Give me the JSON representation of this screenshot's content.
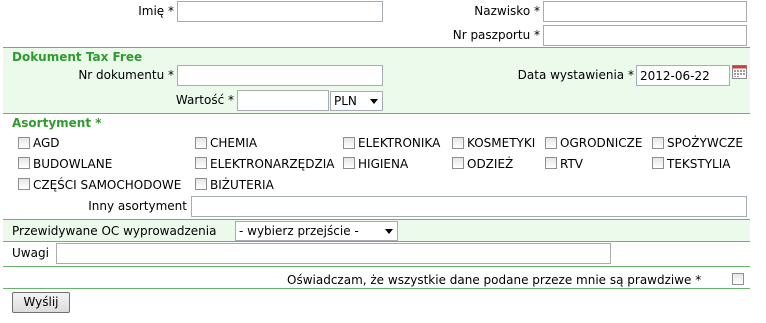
{
  "personal": {
    "first_name_label": "Imię",
    "last_name_label": "Nazwisko",
    "passport_label": "Nr paszportu",
    "required_mark": "*"
  },
  "tax_free": {
    "title": "Dokument Tax Free",
    "doc_number_label": "Nr dokumentu",
    "issue_date_label": "Data wystawienia",
    "issue_date_value": "2012-06-22",
    "value_label": "Wartość",
    "currency": "PLN"
  },
  "assortment": {
    "title": "Asortyment *",
    "items": [
      "AGD",
      "CHEMIA",
      "ELEKTRONIKA",
      "KOSMETYKI",
      "OGRODNICZE",
      "SPOŻYWCZE",
      "BUDOWLANE",
      "ELEKTRONARZĘDZIA",
      "HIGIENA",
      "ODZIEŻ",
      "RTV",
      "TEKSTYLIA",
      "CZĘŚCI SAMOCHODOWE",
      "BIŻUTERIA"
    ],
    "other_label": "Inny asortyment"
  },
  "exit": {
    "label": "Przewidywane OC wyprowadzenia",
    "select_value": "- wybierz przejście -"
  },
  "notes": {
    "label": "Uwagi"
  },
  "declaration": {
    "text": "Oświadczam, że wszystkie dane podane przeze mnie są prawdziwe *"
  },
  "submit": {
    "label": "Wyślij"
  },
  "colors": {
    "section_bg": "#ecfaec",
    "section_title": "#2e9b2e",
    "divider": "#6ab36a"
  }
}
